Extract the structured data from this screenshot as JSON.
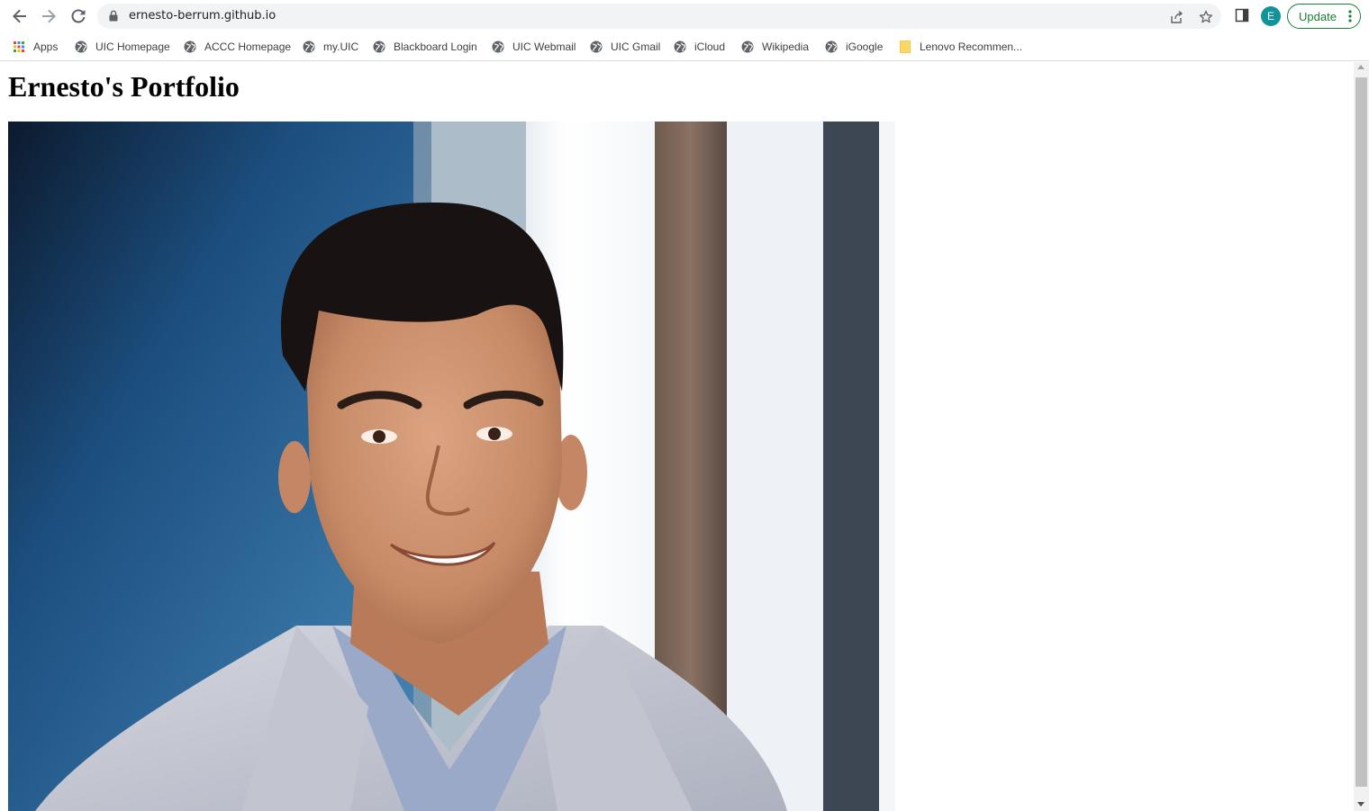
{
  "browser": {
    "url": "ernesto-berrum.github.io",
    "profile_initial": "E",
    "update_label": "Update",
    "colors": {
      "accent_green": "#188038",
      "avatar": "#12939a"
    },
    "icons": [
      "back-arrow-icon",
      "forward-arrow-icon",
      "reload-icon",
      "lock-icon",
      "share-icon",
      "star-icon",
      "side-panel-icon",
      "kebab-menu-icon"
    ]
  },
  "bookmarks": [
    {
      "label": "Apps",
      "icon": "apps-grid-icon"
    },
    {
      "label": "UIC Homepage",
      "icon": "globe-icon"
    },
    {
      "label": "ACCC Homepage",
      "icon": "globe-icon"
    },
    {
      "label": "my.UIC",
      "icon": "globe-icon"
    },
    {
      "label": "Blackboard Login",
      "icon": "globe-icon"
    },
    {
      "label": "UIC Webmail",
      "icon": "globe-icon"
    },
    {
      "label": "UIC Gmail",
      "icon": "globe-icon"
    },
    {
      "label": "iCloud",
      "icon": "globe-icon"
    },
    {
      "label": "Wikipedia",
      "icon": "globe-icon"
    },
    {
      "label": "iGoogle",
      "icon": "globe-icon"
    },
    {
      "label": "Lenovo Recommen...",
      "icon": "folder-icon"
    }
  ],
  "page": {
    "title": "Ernesto's Portfolio"
  }
}
